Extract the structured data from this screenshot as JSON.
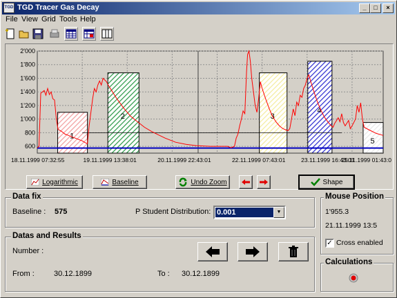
{
  "window": {
    "title": "TGD Tracer Gas Decay",
    "icon_text": "TGD",
    "buttons": {
      "minimize": "_",
      "maximize": "□",
      "close": "×"
    }
  },
  "menu": [
    "File",
    "View",
    "Grid",
    "Tools",
    "Help"
  ],
  "toolbar": [
    "new-file-icon",
    "open-folder-icon",
    "save-disk-icon",
    "print-icon",
    "grid-table-icon",
    "red-grid-icon",
    "columns-icon"
  ],
  "chart_data": {
    "type": "line",
    "ylim": [
      500,
      2000
    ],
    "yticks": [
      "2'000",
      "1'800",
      "1'600",
      "1'400",
      "1'200",
      "1'000",
      "800",
      "600"
    ],
    "xtick_labels": [
      "18.11.1999 07:32:55",
      "19.11.1999 13:38:01",
      "20.11.1999 22:43:01",
      "22.11.1999 07:43:01",
      "23.11.1999 16:43:01",
      "25.11.1999 01:43:0"
    ],
    "baseline": 575,
    "colors": {
      "curve": "#ff0000",
      "baseline": "#0000c0",
      "fit": "#000000"
    },
    "regions": [
      {
        "label": "1",
        "from": 0.059,
        "to": 0.145,
        "top": 1100,
        "color": "#f2a0a0"
      },
      {
        "label": "2",
        "from": 0.204,
        "to": 0.294,
        "top": 1680,
        "color": "#2f9a4a"
      },
      {
        "label": "3",
        "from": 0.642,
        "to": 0.722,
        "top": 1680,
        "color": "#f4eca0"
      },
      {
        "label": "4",
        "from": 0.782,
        "to": 0.852,
        "top": 1850,
        "color": "#3030d0"
      },
      {
        "label": "5",
        "from": 0.942,
        "to": 1.0,
        "top": 950,
        "color": "#e8e8e8"
      }
    ],
    "series_points": [
      [
        0.0,
        580
      ],
      [
        0.005,
        600
      ],
      [
        0.01,
        1380
      ],
      [
        0.02,
        1420
      ],
      [
        0.025,
        1350
      ],
      [
        0.03,
        1450
      ],
      [
        0.035,
        1360
      ],
      [
        0.04,
        1400
      ],
      [
        0.045,
        1300
      ],
      [
        0.05,
        1280
      ],
      [
        0.055,
        1000
      ],
      [
        0.06,
        850
      ],
      [
        0.07,
        820
      ],
      [
        0.08,
        780
      ],
      [
        0.09,
        760
      ],
      [
        0.1,
        740
      ],
      [
        0.11,
        720
      ],
      [
        0.12,
        700
      ],
      [
        0.13,
        680
      ],
      [
        0.14,
        650
      ],
      [
        0.145,
        640
      ],
      [
        0.15,
        900
      ],
      [
        0.16,
        1300
      ],
      [
        0.165,
        1450
      ],
      [
        0.17,
        1400
      ],
      [
        0.175,
        1500
      ],
      [
        0.18,
        1560
      ],
      [
        0.185,
        1500
      ],
      [
        0.19,
        1600
      ],
      [
        0.2,
        1550
      ],
      [
        0.205,
        1500
      ],
      [
        0.215,
        1420
      ],
      [
        0.23,
        1300
      ],
      [
        0.25,
        1160
      ],
      [
        0.27,
        1040
      ],
      [
        0.29,
        960
      ],
      [
        0.31,
        880
      ],
      [
        0.33,
        820
      ],
      [
        0.35,
        770
      ],
      [
        0.37,
        720
      ],
      [
        0.4,
        660
      ],
      [
        0.43,
        630
      ],
      [
        0.46,
        610
      ],
      [
        0.5,
        600
      ],
      [
        0.55,
        600
      ],
      [
        0.56,
        580
      ],
      [
        0.57,
        600
      ],
      [
        0.575,
        720
      ],
      [
        0.58,
        780
      ],
      [
        0.585,
        900
      ],
      [
        0.59,
        1000
      ],
      [
        0.595,
        1120
      ],
      [
        0.6,
        1080
      ],
      [
        0.605,
        1700
      ],
      [
        0.608,
        1950
      ],
      [
        0.612,
        2000
      ],
      [
        0.616,
        1850
      ],
      [
        0.62,
        1600
      ],
      [
        0.625,
        1400
      ],
      [
        0.63,
        1200
      ],
      [
        0.635,
        1100
      ],
      [
        0.64,
        1300
      ],
      [
        0.645,
        1550
      ],
      [
        0.65,
        1450
      ],
      [
        0.66,
        1300
      ],
      [
        0.67,
        1160
      ],
      [
        0.68,
        1040
      ],
      [
        0.69,
        960
      ],
      [
        0.7,
        900
      ],
      [
        0.71,
        860
      ],
      [
        0.72,
        840
      ],
      [
        0.725,
        830
      ],
      [
        0.73,
        860
      ],
      [
        0.735,
        1000
      ],
      [
        0.74,
        1150
      ],
      [
        0.745,
        1050
      ],
      [
        0.75,
        1250
      ],
      [
        0.755,
        1200
      ],
      [
        0.76,
        1350
      ],
      [
        0.765,
        1320
      ],
      [
        0.77,
        1450
      ],
      [
        0.775,
        1500
      ],
      [
        0.78,
        1600
      ],
      [
        0.785,
        1650
      ],
      [
        0.79,
        1560
      ],
      [
        0.8,
        1400
      ],
      [
        0.81,
        1250
      ],
      [
        0.82,
        1130
      ],
      [
        0.83,
        1030
      ],
      [
        0.84,
        960
      ],
      [
        0.85,
        900
      ],
      [
        0.855,
        880
      ],
      [
        0.86,
        940
      ],
      [
        0.87,
        1020
      ],
      [
        0.875,
        960
      ],
      [
        0.88,
        1080
      ],
      [
        0.885,
        950
      ],
      [
        0.89,
        900
      ],
      [
        0.9,
        980
      ],
      [
        0.905,
        860
      ],
      [
        0.91,
        900
      ],
      [
        0.92,
        1000
      ],
      [
        0.925,
        1200
      ],
      [
        0.93,
        1100
      ],
      [
        0.935,
        1240
      ],
      [
        0.94,
        1000
      ],
      [
        0.945,
        880
      ],
      [
        0.96,
        840
      ],
      [
        0.98,
        790
      ],
      [
        1.0,
        760
      ]
    ],
    "fit_line_value": 800
  },
  "buttons": {
    "log": "Logarithmic",
    "baseline": "Baseline",
    "undo_zoom": "Undo Zoom",
    "shape": "Shape"
  },
  "data_fix": {
    "title": "Data fix",
    "baseline_label": "Baseline :",
    "baseline_value": "575",
    "p_label": "P Student Distribution:",
    "p_value": "0.001"
  },
  "mouse": {
    "title": "Mouse Position",
    "value": "1'955.3",
    "time": "21.11.1999 13:5",
    "cross_label": "Cross enabled"
  },
  "results": {
    "title": "Datas and Results",
    "number_label": "Number :",
    "from_label": "From :",
    "from_value": "30.12.1899",
    "to_label": "To :",
    "to_value": "30.12.1899"
  },
  "calculations": {
    "title": "Calculations"
  }
}
